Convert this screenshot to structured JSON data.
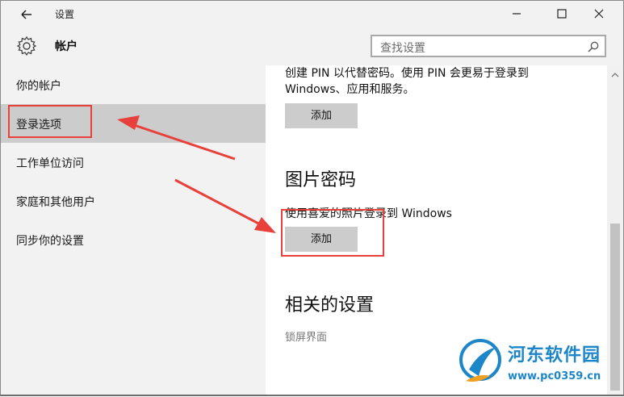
{
  "window": {
    "title": "设置"
  },
  "header": {
    "page_title": "帐户",
    "search_placeholder": "查找设置"
  },
  "sidebar": {
    "items": [
      {
        "label": "你的帐户",
        "selected": false
      },
      {
        "label": "登录选项",
        "selected": true
      },
      {
        "label": "工作单位访问",
        "selected": false
      },
      {
        "label": "家庭和其他用户",
        "selected": false
      },
      {
        "label": "同步你的设置",
        "selected": false
      }
    ]
  },
  "content": {
    "pin": {
      "description_line1": "创建 PIN 以代替密码。使用 PIN 会更易于登录到",
      "description_line2": "Windows、应用和服务。",
      "add_label": "添加"
    },
    "picture_password": {
      "title": "图片密码",
      "description": "使用喜爱的照片登录到 Windows",
      "add_label": "添加"
    },
    "related": {
      "title": "相关的设置",
      "link": "锁屏界面"
    }
  },
  "watermark": {
    "name": "河东软件园",
    "url": "www.pc0359.cn"
  },
  "colors": {
    "annotation": "#e8403a",
    "selected_bg": "#cccccc",
    "chrome_bg": "#f2f2f2",
    "button_bg": "#cccccc",
    "watermark": "#1c86c8"
  },
  "icons": [
    "back-arrow-icon",
    "minimize-icon",
    "maximize-icon",
    "close-icon",
    "gear-icon",
    "search-icon"
  ]
}
